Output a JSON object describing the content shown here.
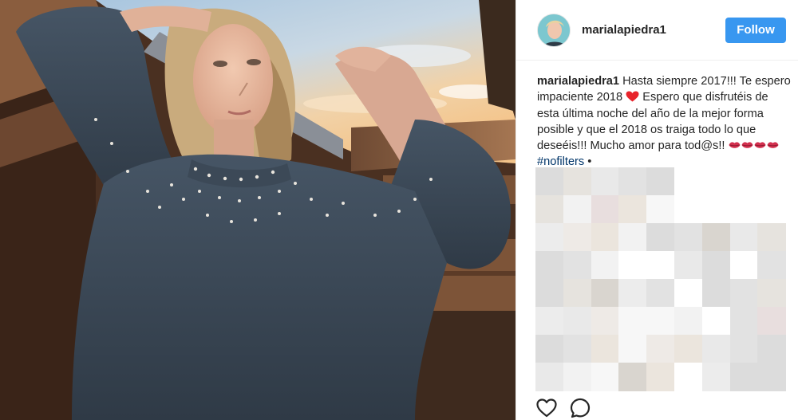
{
  "post": {
    "photo": {
      "icon": "portrait-photo"
    },
    "header": {
      "avatar_icon": "profile-avatar",
      "username": "marialapiedra1",
      "follow_label": "Follow"
    },
    "caption": {
      "username": "marialapiedra1",
      "text_part1": " Hasta siempre 2017!!! Te espero impaciente 2018 ",
      "heart_icon": "red-heart-emoji",
      "text_part2": " Espero que disfrutéis de esta última noche del año de la mejor forma posible y que el 2018 os traiga todo lo que deseéis!!! Mucho amor para tod@s!! ",
      "lips_icon": "kiss-mark-emoji",
      "lips_count": 4,
      "hashtag": "#nofilters",
      "bullet": " •"
    },
    "comments_area": {
      "icon": "pixelated-blur"
    },
    "actions": {
      "like_icon": "heart-outline-icon",
      "comment_icon": "comment-bubble-icon"
    }
  },
  "colors": {
    "accent": "#3897f0",
    "text": "#262626",
    "hashtag": "#003569",
    "divider": "#efefef"
  }
}
